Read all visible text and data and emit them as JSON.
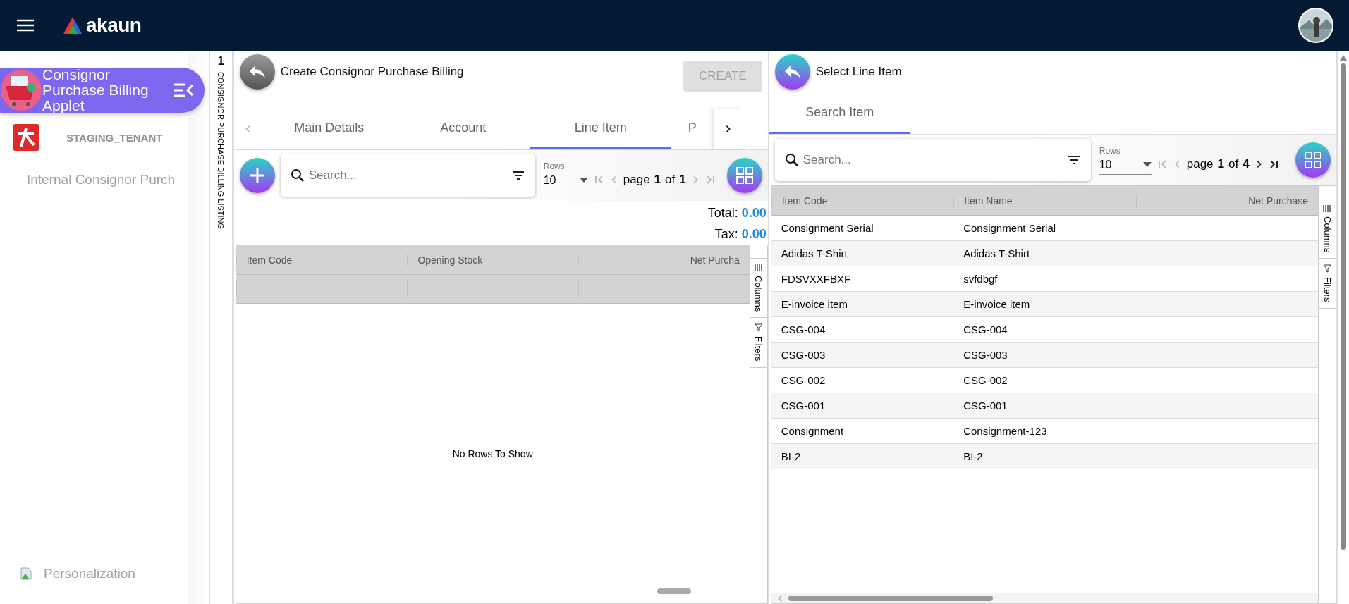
{
  "topbar": {
    "logo_text": "akaun"
  },
  "sidebar": {
    "applet_title": "Consignor Purchase Billing Applet",
    "tenant": "STAGING_TENANT",
    "items": [
      {
        "label": "Internal Consignor Purch"
      }
    ],
    "footer": "Personalization"
  },
  "listing_strip": {
    "count": "1",
    "label": "CONSIGNOR PURCHASE BILLING LISTING"
  },
  "main_panel": {
    "title": "Create Consignor Purchase Billing",
    "create_button": {
      "label": "CREATE",
      "disabled": true
    },
    "tabs": [
      {
        "label": "Main Details",
        "selected": false
      },
      {
        "label": "Account",
        "selected": false
      },
      {
        "label": "Line Item",
        "selected": true
      },
      {
        "label": "P",
        "selected": false
      }
    ],
    "toolbar": {
      "placeholder": "Search...",
      "rows_label": "Rows",
      "rows_value": "10",
      "page_word": "page",
      "page": "1",
      "of_word": "of",
      "pages": "1",
      "can_go_back": false,
      "can_go_forward": false
    },
    "totals": [
      {
        "label": "Total:",
        "value": "0.00"
      },
      {
        "label": "Tax:",
        "value": "0.00"
      }
    ],
    "table": {
      "columns": [
        "Item Code",
        "Opening Stock",
        "Net Purcha"
      ],
      "empty_message": "No Rows To Show"
    },
    "side_buttons": [
      "Columns",
      "Filters"
    ]
  },
  "item_panel": {
    "title": "Select Line Item",
    "tabs": [
      {
        "label": "Search Item",
        "selected": true
      }
    ],
    "toolbar": {
      "placeholder": "Search...",
      "rows_label": "Rows",
      "rows_value": "10",
      "page_word": "page",
      "page": "1",
      "of_word": "of",
      "pages": "4",
      "can_go_back": false,
      "can_go_forward": true
    },
    "table": {
      "columns": [
        "Item Code",
        "Item Name",
        "Net Purchase"
      ],
      "rows": [
        [
          "Consignment Serial",
          "Consignment Serial"
        ],
        [
          "Adidas T-Shirt",
          "Adidas T-Shirt"
        ],
        [
          "FDSVXXFBXF",
          "svfdbgf"
        ],
        [
          "E-invoice item",
          "E-invoice item"
        ],
        [
          "CSG-004",
          "CSG-004"
        ],
        [
          "CSG-003",
          "CSG-003"
        ],
        [
          "CSG-002",
          "CSG-002"
        ],
        [
          "CSG-001",
          "CSG-001"
        ],
        [
          "Consignment",
          "Consignment-123"
        ],
        [
          "BI-2",
          "BI-2"
        ]
      ]
    },
    "side_buttons": [
      "Columns",
      "Filters"
    ]
  }
}
